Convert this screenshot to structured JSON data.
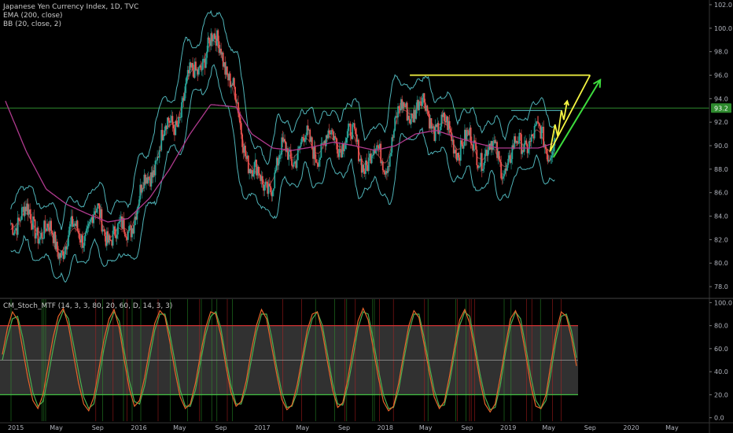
{
  "legend": {
    "title": "Japanese Yen Currency Index, 1D, TVC",
    "ema": "EMA (200, close)",
    "bb": "BB (20, close, 2)",
    "stoch": "CM_Stoch_MTF (14, 3, 3, 80, 20, 60, D, 14, 3, 3)"
  },
  "colors": {
    "background": "#000000",
    "candle_up": "#26a69a",
    "candle_down": "#ef5350",
    "ema": "#b03a8e",
    "bb_band": "#4fb3b8",
    "bb_basis": "#8a3a3a",
    "horizontal_line": "#2e8b2e",
    "drawing_yellow": "#f5f542",
    "drawing_green": "#3ddc3d",
    "drawing_teal": "#4fb3b8",
    "stoch_k": "#e8642a",
    "stoch_d": "#4caf50",
    "stoch_fill": "#3a3a3a",
    "level_upper": "#d03030",
    "level_lower": "#40c040",
    "level_mid": "#9a9a9a"
  },
  "price_tag": "93.2",
  "chart_data": [
    {
      "type": "candlestick",
      "title": "Japanese Yen Currency Index, 1D, TVC",
      "x_ticks": [
        "2015",
        "May",
        "Sep",
        "2016",
        "May",
        "Sep",
        "2017",
        "May",
        "Sep",
        "2018",
        "May",
        "Sep",
        "2019",
        "May",
        "Sep",
        "2020",
        "May"
      ],
      "y_ticks": [
        "102.0",
        "100.0",
        "98.0",
        "96.0",
        "94.0",
        "92.0",
        "90.0",
        "88.0",
        "86.0",
        "84.0",
        "82.0",
        "80.0",
        "78.0"
      ],
      "ylim": [
        77.2,
        102.4
      ],
      "grid": false,
      "horizontal_line": 93.2,
      "series": [
        {
          "name": "EMA (200, close)",
          "x": [
            "2014-12-01",
            "2015-02-01",
            "2015-04-01",
            "2015-06-01",
            "2015-08-01",
            "2015-10-01",
            "2015-12-01",
            "2016-02-01",
            "2016-04-01",
            "2016-06-01",
            "2016-08-01",
            "2016-10-15",
            "2016-12-01",
            "2017-02-01",
            "2017-04-01",
            "2017-06-01",
            "2017-08-01",
            "2017-10-01",
            "2017-12-01",
            "2018-02-01",
            "2018-04-01",
            "2018-06-01",
            "2018-08-01",
            "2018-10-01",
            "2018-12-01",
            "2019-02-01",
            "2019-04-01",
            "2019-05-15"
          ],
          "values": [
            93.8,
            89.5,
            86.3,
            85.0,
            84.2,
            83.5,
            83.8,
            85.5,
            88.0,
            91.0,
            93.5,
            93.3,
            91.0,
            89.8,
            89.6,
            89.9,
            90.3,
            90.0,
            89.6,
            90.0,
            91.0,
            91.3,
            90.7,
            90.2,
            89.8,
            89.8,
            89.8,
            90.2
          ]
        },
        {
          "name": "BB (20, close, 2)",
          "x": [
            "2015-01-01",
            "2015-03-01",
            "2015-05-01",
            "2015-07-01",
            "2015-09-01",
            "2015-11-01",
            "2016-01-01",
            "2016-03-01",
            "2016-05-01",
            "2016-07-01",
            "2016-09-01",
            "2016-11-01",
            "2017-01-01",
            "2017-03-01",
            "2017-05-01",
            "2017-07-01",
            "2017-09-01",
            "2017-11-01",
            "2018-01-01",
            "2018-03-01",
            "2018-05-01",
            "2018-07-01",
            "2018-09-01",
            "2018-11-01",
            "2019-01-01",
            "2019-03-01",
            "2019-05-01",
            "2019-05-20"
          ],
          "values": [
            84.0,
            83.5,
            81.5,
            82.5,
            83.8,
            82.0,
            85.0,
            90.0,
            93.0,
            97.5,
            99.0,
            91.0,
            86.0,
            89.0,
            90.0,
            90.0,
            91.0,
            89.0,
            89.0,
            93.5,
            93.0,
            91.0,
            90.0,
            89.5,
            88.5,
            91.0,
            90.0,
            91.5
          ]
        }
      ],
      "annotations": [
        {
          "type": "line",
          "color": "yellow",
          "x": [
            "2018-03-15",
            "2019-09-01"
          ],
          "y": [
            96.0,
            96.0
          ]
        },
        {
          "type": "line",
          "color": "yellow",
          "x": [
            "2019-05-05",
            "2019-09-01"
          ],
          "y": [
            89.5,
            96.0
          ]
        },
        {
          "type": "line",
          "color": "teal",
          "x": [
            "2019-01-10",
            "2019-06-10"
          ],
          "y": [
            93.0,
            93.0
          ]
        },
        {
          "type": "zigzag",
          "color": "yellow",
          "x": [
            "2019-05-05",
            "2019-05-20",
            "2019-05-28",
            "2019-06-08",
            "2019-06-15",
            "2019-06-25"
          ],
          "y": [
            89.5,
            91.8,
            90.8,
            93.0,
            92.2,
            93.8
          ]
        },
        {
          "type": "arrow",
          "color": "green",
          "x": [
            "2019-05-15",
            "2019-10-01"
          ],
          "y": [
            89.0,
            95.6
          ]
        }
      ]
    },
    {
      "type": "line",
      "title": "CM_Stoch_MTF (14, 3, 3, 80, 20, 60, D, 14, 3, 3)",
      "y_ticks": [
        "100.0",
        "80.0",
        "60.0",
        "40.0",
        "20.0",
        "0.0"
      ],
      "ylim": [
        -3,
        103
      ],
      "levels": [
        80,
        50,
        20
      ],
      "series": [
        {
          "name": "K",
          "values": [
            55,
            78,
            92,
            85,
            60,
            35,
            15,
            8,
            20,
            45,
            70,
            88,
            95,
            80,
            55,
            30,
            12,
            6,
            18,
            42,
            68,
            86,
            94,
            78,
            50,
            25,
            10,
            15,
            35,
            60,
            82,
            93,
            88,
            65,
            40,
            18,
            8,
            12,
            30,
            55,
            78,
            92,
            90,
            72,
            45,
            22,
            10,
            14,
            32,
            58,
            80,
            94,
            86,
            62,
            38,
            16,
            7,
            11,
            28,
            52,
            76,
            90,
            92,
            74,
            48,
            24,
            9,
            13,
            34,
            60,
            84,
            95,
            85,
            60,
            35,
            14,
            6,
            10,
            30,
            56,
            80,
            93,
            87,
            64,
            40,
            18,
            8,
            14,
            36,
            62,
            85,
            94,
            82,
            58,
            32,
            12,
            5,
            12,
            35,
            62,
            86,
            93,
            80,
            55,
            28,
            10,
            8,
            20,
            48,
            75,
            92,
            88,
            70,
            45
          ]
        },
        {
          "name": "D",
          "values": [
            50,
            70,
            86,
            88,
            70,
            45,
            22,
            10,
            14,
            35,
            60,
            82,
            93,
            86,
            64,
            40,
            18,
            8,
            12,
            34,
            60,
            80,
            92,
            84,
            58,
            32,
            14,
            12,
            28,
            52,
            76,
            90,
            90,
            72,
            48,
            24,
            10,
            10,
            24,
            48,
            72,
            88,
            92,
            78,
            52,
            28,
            12,
            12,
            26,
            50,
            74,
            90,
            90,
            70,
            44,
            22,
            9,
            10,
            22,
            46,
            70,
            86,
            92,
            80,
            55,
            30,
            12,
            11,
            28,
            52,
            78,
            92,
            90,
            68,
            42,
            20,
            8,
            9,
            24,
            50,
            74,
            90,
            90,
            70,
            46,
            24,
            10,
            11,
            30,
            56,
            80,
            92,
            88,
            64,
            38,
            18,
            7,
            9,
            28,
            56,
            80,
            92,
            86,
            62,
            36,
            15,
            8,
            15,
            40,
            68,
            88,
            90,
            76,
            52
          ]
        }
      ]
    }
  ]
}
